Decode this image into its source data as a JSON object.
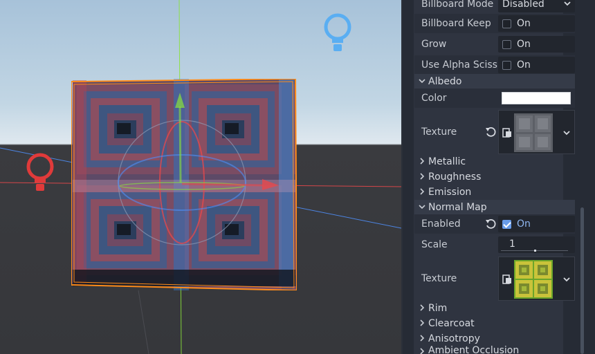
{
  "inspector": {
    "billboard_mode": {
      "label": "Billboard Mode",
      "value": "Disabled"
    },
    "billboard_keep": {
      "label": "Billboard Keep",
      "checkbox": "On",
      "checked": false
    },
    "grow": {
      "label": "Grow",
      "checkbox": "On",
      "checked": false
    },
    "alpha_scissor": {
      "label": "Use Alpha Sciss",
      "checkbox": "On",
      "checked": false
    },
    "albedo": {
      "section": "Albedo",
      "color_label": "Color",
      "color_value": "#ffffff",
      "texture_label": "Texture"
    },
    "collapsed_sections_1": [
      "Metallic",
      "Roughness",
      "Emission"
    ],
    "normal_map": {
      "section": "Normal Map",
      "enabled_label": "Enabled",
      "enabled_checkbox": "On",
      "enabled": true,
      "scale_label": "Scale",
      "scale_value": "1",
      "texture_label": "Texture"
    },
    "collapsed_sections_2": [
      "Rim",
      "Clearcoat",
      "Anisotropy",
      "Ambient Occlusion"
    ]
  },
  "icons": {
    "revert": "revert-icon",
    "resource": "resource-icon",
    "dropdown": "chevron-down-icon",
    "light": "omni-light-icon"
  },
  "colors": {
    "accent": "#699ce8",
    "selection": "#ff8c1a",
    "axis_x": "#e8484b",
    "axis_y": "#8ae23a",
    "axis_z": "#4f8ef7"
  }
}
